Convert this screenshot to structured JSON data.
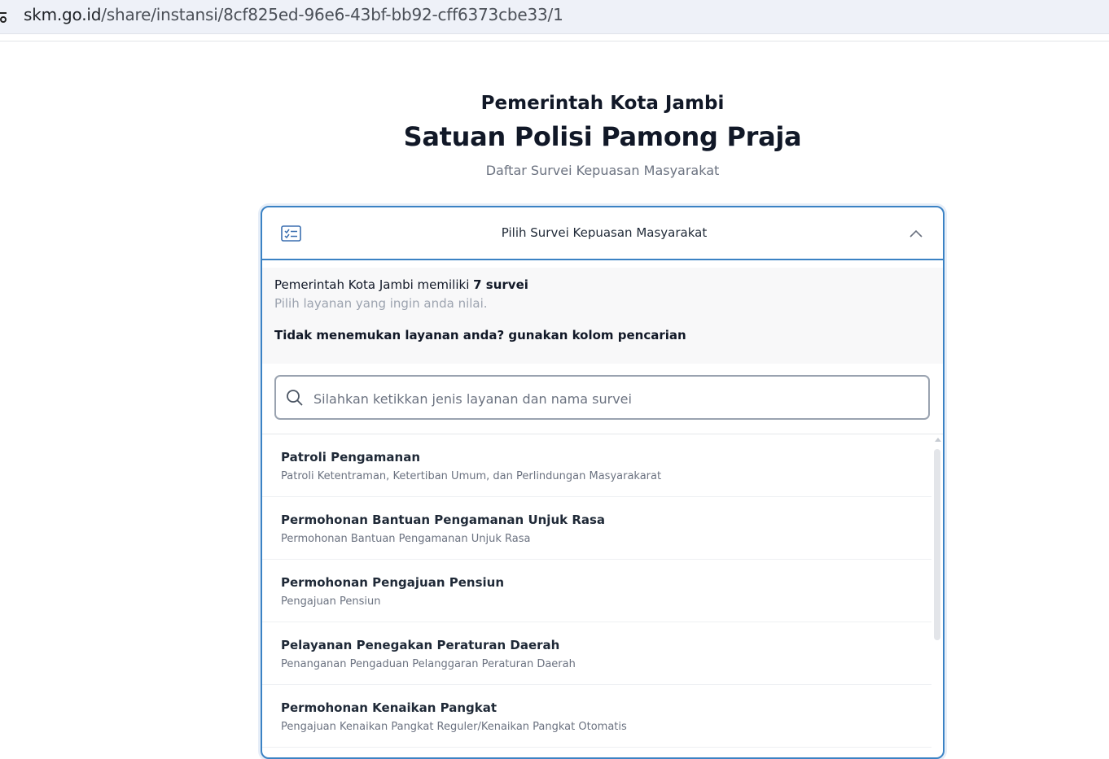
{
  "browser": {
    "url_host": "skm.go.id",
    "url_path": "/share/instansi/8cf825ed-96e6-43bf-bb92-cff6373cbe33/1"
  },
  "header": {
    "org": "Pemerintah Kota Jambi",
    "title": "Satuan Polisi Pamong Praja",
    "subtitle": "Daftar Survei Kepuasan Masyarakat"
  },
  "panel": {
    "title": "Pilih Survei Kepuasan Masyarakat",
    "info_prefix": "Pemerintah Kota Jambi memiliki ",
    "info_count": "7 survei",
    "info_hint": "Pilih layanan yang ingin anda nilai.",
    "info_search_hint": "Tidak menemukan layanan anda? gunakan kolom pencarian"
  },
  "search": {
    "placeholder": "Silahkan ketikkan jenis layanan dan nama survei",
    "value": ""
  },
  "surveys": [
    {
      "title": "Patroli Pengamanan",
      "subtitle": "Patroli Ketentraman, Ketertiban Umum, dan Perlindungan Masyarakarat"
    },
    {
      "title": "Permohonan Bantuan Pengamanan Unjuk Rasa",
      "subtitle": "Permohonan Bantuan Pengamanan Unjuk Rasa"
    },
    {
      "title": "Permohonan Pengajuan Pensiun",
      "subtitle": "Pengajuan Pensiun"
    },
    {
      "title": "Pelayanan Penegakan Peraturan Daerah",
      "subtitle": "Penanganan Pengaduan Pelanggaran Peraturan Daerah"
    },
    {
      "title": "Permohonan Kenaikan Pangkat",
      "subtitle": "Pengajuan Kenaikan Pangkat Reguler/Kenaikan Pangkat Otomatis"
    }
  ],
  "colors": {
    "accent": "#3b82c4",
    "text": "#111827",
    "muted": "#6b7280"
  },
  "icons": {
    "url": "site-info-icon",
    "panel": "checklist-icon",
    "toggle": "chevron-up-icon",
    "search": "search-icon"
  }
}
